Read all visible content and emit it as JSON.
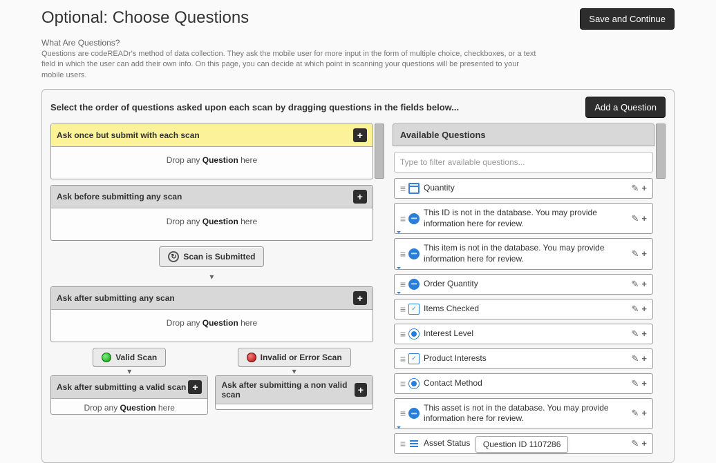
{
  "header": {
    "title": "Optional: Choose Questions",
    "intro_label": "What Are Questions?",
    "intro_text": "Questions are codeREADr's method of data collection. They ask the mobile user for more input in the form of multiple choice, checkboxes, or a text field in which the user can add their own info. On this page, you can decide at which point in scanning your questions will be presented to your mobile users.",
    "save_label": "Save and Continue"
  },
  "panel": {
    "instruction": "Select the order of questions asked upon each scan by dragging questions in the fields below...",
    "add_question_label": "Add a Question"
  },
  "zones": {
    "once": {
      "title": "Ask once but submit with each scan",
      "drop_hint_prefix": "Drop any ",
      "drop_hint_word": "Question",
      "drop_hint_suffix": " here"
    },
    "before": {
      "title": "Ask before submitting any scan"
    },
    "after": {
      "title": "Ask after submitting any scan"
    },
    "after_valid": {
      "title": "Ask after submitting a valid scan"
    },
    "after_invalid": {
      "title": "Ask after submitting a non valid scan"
    }
  },
  "milestones": {
    "submitted": "Scan is Submitted",
    "valid": "Valid Scan",
    "invalid": "Invalid or Error Scan"
  },
  "available": {
    "header": "Available Questions",
    "filter_placeholder": "Type to filter available questions...",
    "items": [
      {
        "icon": "note",
        "label": "Quantity"
      },
      {
        "icon": "chat",
        "label": "This ID is not in the database. You may provide information here for review."
      },
      {
        "icon": "chat",
        "label": "This item is not in the database. You may provide information here for review."
      },
      {
        "icon": "chat",
        "label": "Order Quantity"
      },
      {
        "icon": "check",
        "label": "Items Checked"
      },
      {
        "icon": "radio",
        "label": "Interest Level"
      },
      {
        "icon": "check",
        "label": "Product Interests"
      },
      {
        "icon": "radio",
        "label": "Contact Method"
      },
      {
        "icon": "chat",
        "label": "This asset is not in the database. You may provide information here for review."
      },
      {
        "icon": "list",
        "label": "Asset Status"
      }
    ]
  },
  "tooltip": {
    "text": "Question ID 1107286"
  }
}
